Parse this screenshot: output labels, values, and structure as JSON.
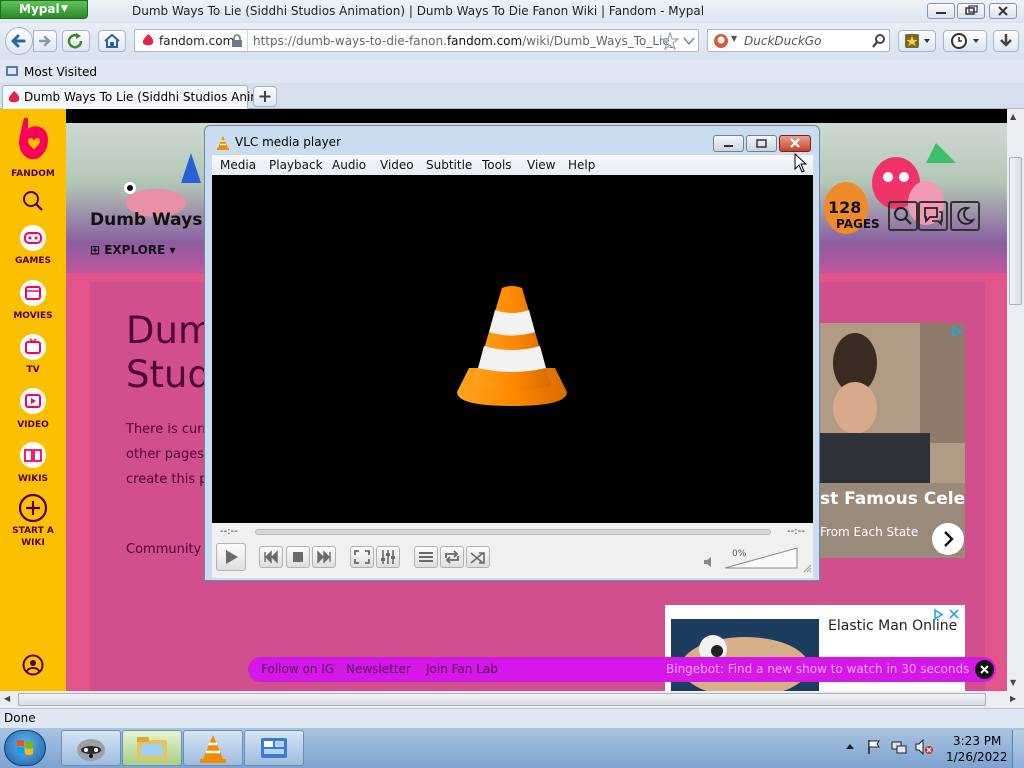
{
  "browser": {
    "app_button": "Mypal",
    "window_title": "Dumb Ways To Lie (Siddhi Studios Animation) | Dumb Ways To Die Fanon Wiki | Fandom - Mypal",
    "identity": "fandom.com",
    "url_prefix": "https://dumb-ways-to-die-fanon.",
    "url_domain": "fandom.com",
    "url_suffix": "/wiki/Dumb_Ways_To_Lie_(Si",
    "search_placeholder": "DuckDuckGo",
    "bookmark_item": "Most Visited",
    "tab_title": "Dumb Ways To Lie (Siddhi Studios Anim...",
    "status": "Done"
  },
  "sidebar": {
    "items": [
      {
        "label": "FANDOM",
        "icon": "fandom-logo-icon"
      },
      {
        "label": "",
        "icon": "search-icon"
      },
      {
        "label": "GAMES",
        "icon": "gamepad-icon"
      },
      {
        "label": "MOVIES",
        "icon": "movie-icon"
      },
      {
        "label": "TV",
        "icon": "tv-icon"
      },
      {
        "label": "VIDEO",
        "icon": "play-icon"
      },
      {
        "label": "WIKIS",
        "icon": "book-icon"
      },
      {
        "label": "START A",
        "icon": "plus-circle-icon"
      },
      {
        "label": "WIKI",
        "icon": ""
      }
    ]
  },
  "wiki": {
    "name": "Dumb Ways T",
    "explore": "EXPLORE",
    "pages_count": "128",
    "pages_label": "PAGES",
    "title_line1": "Dumb",
    "title_line2": "Stud",
    "body_line1": "There is curr",
    "body_line2": "other pages",
    "body_line3": "create this p",
    "community": "Community"
  },
  "ads": {
    "ad1_title": "st Famous Celeb",
    "ad1_subtitle": "From Each State",
    "ad2_title": "Elastic Man Online"
  },
  "fanbar": {
    "follow": "Follow on IG",
    "newsletter": "Newsletter",
    "join": "Join Fan Lab",
    "bingebot": "Bingebot: Find a new show to watch in 30 seconds"
  },
  "vlc": {
    "title": "VLC media player",
    "menu": [
      "Media",
      "Playback",
      "Audio",
      "Video",
      "Subtitle",
      "Tools",
      "View",
      "Help"
    ],
    "time_elapsed": "--:--",
    "time_total": "--:--",
    "volume": "0%"
  },
  "taskbar": {
    "time": "3:23 PM",
    "date": "1/26/2022"
  },
  "colors": {
    "fandom_yellow": "#fbc100",
    "fandom_pink": "#e2558a",
    "vlc_orange": "#f28b00"
  }
}
